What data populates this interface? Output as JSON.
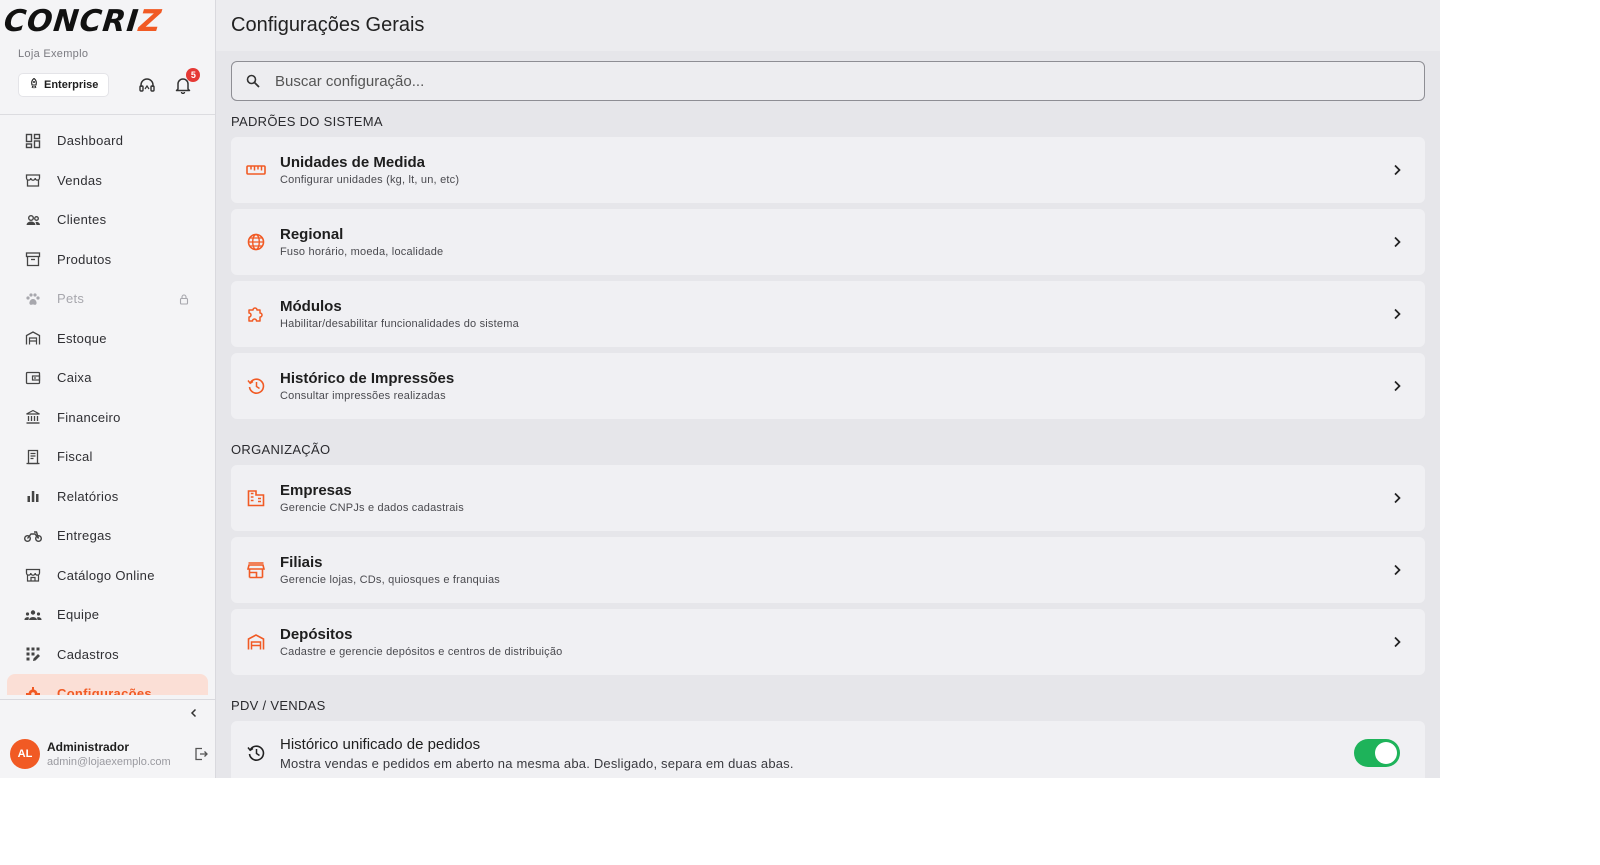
{
  "brand": {
    "logo_main": "CONCRI",
    "logo_accent": "Z",
    "store_name": "Loja Exemplo"
  },
  "header": {
    "plan": "Enterprise",
    "notifications_count": "5"
  },
  "sidebar": {
    "items": [
      {
        "label": "Dashboard",
        "icon": "dashboard-icon"
      },
      {
        "label": "Vendas",
        "icon": "store-icon"
      },
      {
        "label": "Clientes",
        "icon": "people-icon"
      },
      {
        "label": "Produtos",
        "icon": "archive-icon"
      },
      {
        "label": "Pets",
        "icon": "paw-icon",
        "locked": true
      },
      {
        "label": "Estoque",
        "icon": "warehouse-icon"
      },
      {
        "label": "Caixa",
        "icon": "wallet-icon"
      },
      {
        "label": "Financeiro",
        "icon": "bank-icon"
      },
      {
        "label": "Fiscal",
        "icon": "receipt-icon"
      },
      {
        "label": "Relatórios",
        "icon": "bar-chart-icon"
      },
      {
        "label": "Entregas",
        "icon": "motorcycle-icon"
      },
      {
        "label": "Catálogo Online",
        "icon": "storefront-icon"
      },
      {
        "label": "Equipe",
        "icon": "team-icon"
      },
      {
        "label": "Cadastros",
        "icon": "grid-edit-icon"
      },
      {
        "label": "Configurações",
        "icon": "gear-icon",
        "active": true
      }
    ]
  },
  "user": {
    "initials": "AL",
    "name": "Administrador",
    "email": "admin@lojaexemplo.com"
  },
  "page": {
    "title": "Configurações Gerais"
  },
  "search": {
    "placeholder": "Buscar configuração..."
  },
  "sections": {
    "system": {
      "title": "PADRÕES DO SISTEMA",
      "cards": [
        {
          "title": "Unidades de Medida",
          "subtitle": "Configurar unidades (kg, lt, un, etc)",
          "icon": "ruler-icon"
        },
        {
          "title": "Regional",
          "subtitle": "Fuso horário, moeda, localidade",
          "icon": "globe-icon"
        },
        {
          "title": "Módulos",
          "subtitle": "Habilitar/desabilitar funcionalidades do sistema",
          "icon": "puzzle-icon"
        },
        {
          "title": "Histórico de Impressões",
          "subtitle": "Consultar impressões realizadas",
          "icon": "history-icon"
        }
      ]
    },
    "org": {
      "title": "ORGANIZAÇÃO",
      "cards": [
        {
          "title": "Empresas",
          "subtitle": "Gerencie CNPJs e dados cadastrais",
          "icon": "building-icon"
        },
        {
          "title": "Filiais",
          "subtitle": "Gerencie lojas, CDs, quiosques e franquias",
          "icon": "store-icon"
        },
        {
          "title": "Depósitos",
          "subtitle": "Cadastre e gerencie depósitos e centros de distribuição",
          "icon": "warehouse-icon"
        }
      ]
    },
    "pdv": {
      "title": "PDV / VENDAS",
      "toggle": {
        "title": "Histórico unificado de pedidos",
        "subtitle": "Mostra vendas e pedidos em aberto na mesma aba. Desligado, separa em duas abas.",
        "enabled": true
      }
    }
  },
  "colors": {
    "accent": "#f15a24",
    "toggle_on": "#1eb35a",
    "badge": "#e53935",
    "active_bg": "#fbdfd6"
  }
}
